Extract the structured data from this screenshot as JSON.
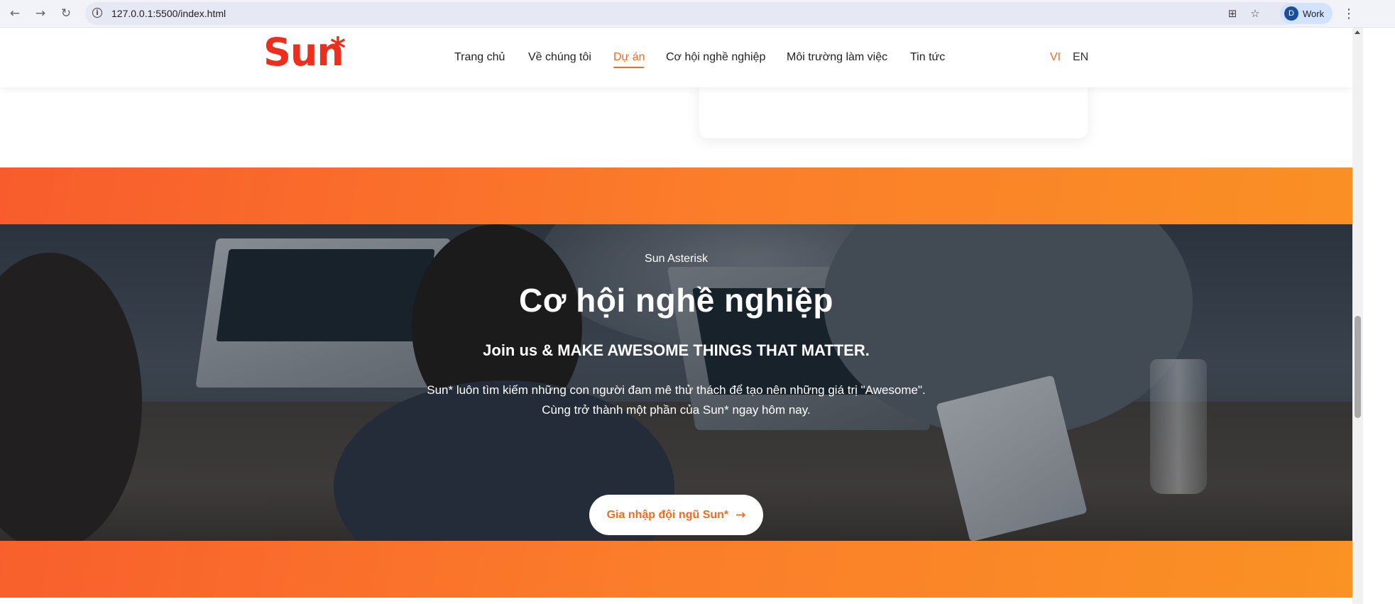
{
  "browser": {
    "url": "127.0.0.1:5500/index.html",
    "profile_initial": "D",
    "profile_name": "Work",
    "icons": [
      "back-arrow-icon",
      "forward-arrow-icon",
      "reload-icon",
      "site-info-icon",
      "translate-icon",
      "star-icon",
      "more-icon"
    ]
  },
  "site": {
    "logo_text": "Sun",
    "logo_star": "*",
    "brand_color": "#ec2f1c",
    "accent_color": "#f26b21",
    "nav": [
      {
        "label": "Trang chủ",
        "active": false
      },
      {
        "label": "Về chúng tôi",
        "active": false
      },
      {
        "label": "Dự án",
        "active": true
      },
      {
        "label": "Cơ hội nghề nghiệp",
        "active": false
      },
      {
        "label": "Môi trường làm việc",
        "active": false
      },
      {
        "label": "Tin tức",
        "active": false
      }
    ],
    "languages": [
      {
        "label": "VI",
        "active": true
      },
      {
        "label": "EN",
        "active": false
      }
    ]
  },
  "career": {
    "eyebrow": "Sun Asterisk",
    "title": "Cơ hội nghề nghiệp",
    "tagline": "Join us & MAKE AWESOME THINGS THAT MATTER.",
    "description_line1": "Sun* luôn tìm kiếm những con người đam mê thử thách để tạo nên những giá trị \"Awesome\".",
    "description_line2": "Cùng trở thành một phần của Sun* ngay hôm nay.",
    "cta_label": "Gia nhập đội ngũ Sun*",
    "cta_icon": "arrow-right-icon"
  }
}
